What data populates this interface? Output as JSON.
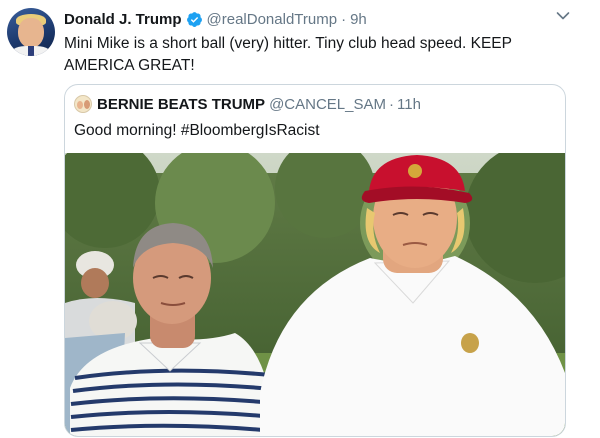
{
  "tweet": {
    "author_name": "Donald J. Trump",
    "handle": "@realDonaldTrump",
    "separator": "·",
    "time": "9h",
    "text": "Mini Mike is a short ball (very) hitter. Tiny club head speed. KEEP AMERICA GREAT!",
    "avatar_icon": "profile-photo",
    "verified_icon": "verified-badge-icon",
    "menu_icon": "chevron-down-icon"
  },
  "quoted_tweet": {
    "author_name": "BERNIE BEATS TRUMP",
    "handle": "@CANCEL_SAM",
    "separator": "·",
    "time": "11h",
    "text": "Good morning! #BloombergIsRacist",
    "avatar_icon": "profile-photo"
  },
  "colors": {
    "text_primary": "#14171a",
    "text_secondary": "#657786",
    "verified_blue": "#1da1f2",
    "border": "#ccd6dd",
    "cap_red": "#c8102e"
  }
}
